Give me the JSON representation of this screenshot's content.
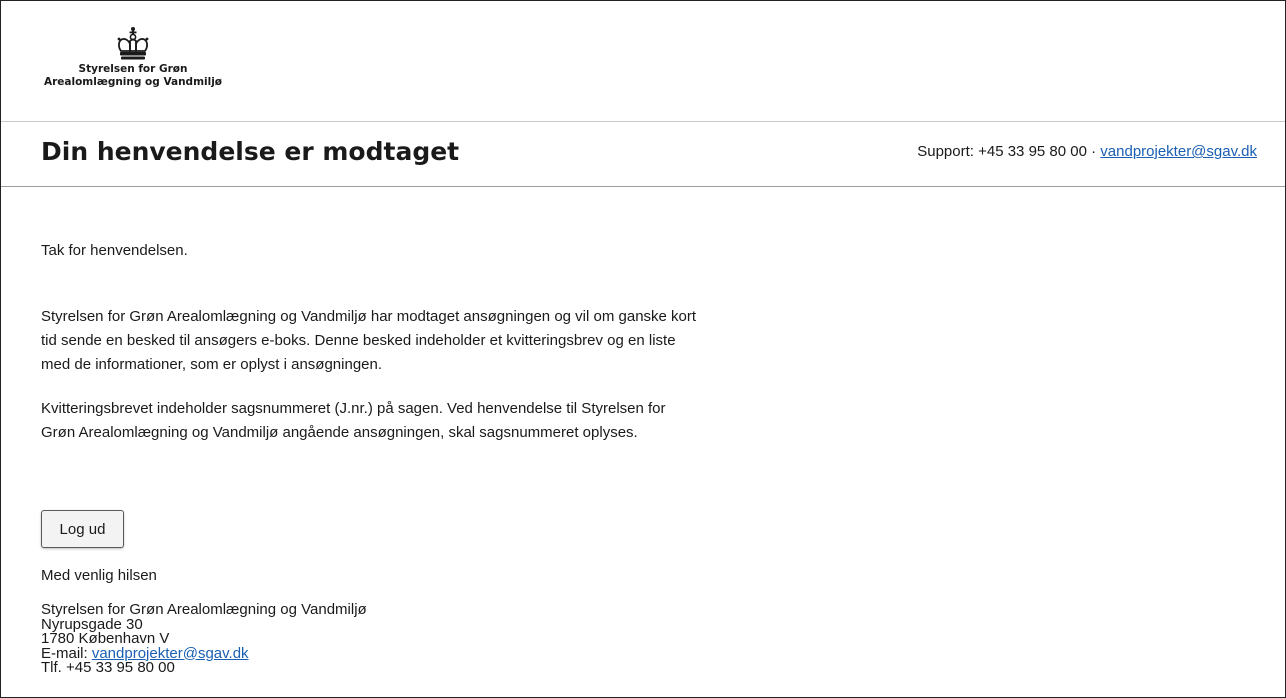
{
  "logo": {
    "icon": "crown-icon",
    "line1": "Styrelsen for Grøn",
    "line2": "Arealomlægning og Vandmiljø"
  },
  "header": {
    "title": "Din henvendelse er modtaget",
    "support_prefix": "Support: +45 33 95 80 00 · ",
    "support_email": "vandprojekter@sgav.dk"
  },
  "main": {
    "thanks": "Tak for henvendelsen.",
    "paragraph1": "Styrelsen for Grøn Arealomlægning og Vandmiljø har modtaget ansøgningen og vil om ganske kort tid sende en besked til ansøgers e-boks. Denne besked indeholder et kvitteringsbrev og en liste med de informationer, som er oplyst i ansøgningen.",
    "paragraph2": "Kvitteringsbrevet indeholder sagsnummeret (J.nr.) på sagen. Ved henvendelse til Styrelsen for Grøn Arealomlægning og Vandmiljø angående ansøgningen, skal sagsnummeret oplyses.",
    "logout_label": "Log ud",
    "greeting": "Med venlig hilsen"
  },
  "address": {
    "org": "Styrelsen for Grøn Arealomlægning og Vandmiljø",
    "street": "Nyrupsgade 30",
    "city": "1780 København V",
    "email_prefix": "E-mail: ",
    "email": "vandprojekter@sgav.dk",
    "phone": "Tlf. +45 33 95 80 00"
  },
  "colors": {
    "link": "#1a5fb4",
    "text": "#1a1a1a",
    "divider": "#c9c9c9"
  }
}
